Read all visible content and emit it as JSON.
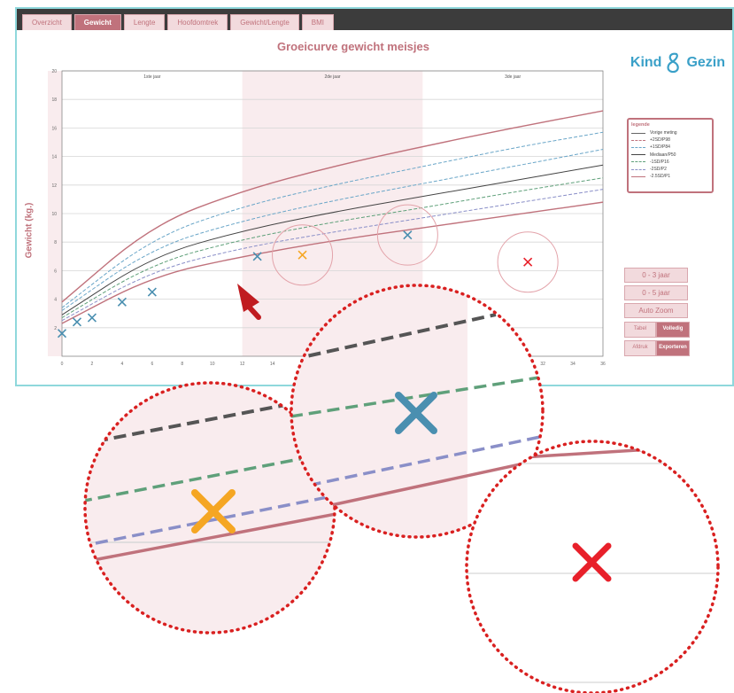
{
  "tabs": [
    {
      "label": "Overzicht",
      "active": false
    },
    {
      "label": "Gewicht",
      "active": true
    },
    {
      "label": "Lengte",
      "active": false
    },
    {
      "label": "Hoofdomtrek",
      "active": false
    },
    {
      "label": "Gewicht/Lengte",
      "active": false
    },
    {
      "label": "BMI",
      "active": false
    }
  ],
  "chart": {
    "title": "Groeicurve gewicht meisjes",
    "ylabel": "Gewicht (kg.)",
    "year_labels": [
      "1ste jaar",
      "2de jaar",
      "3de jaar"
    ]
  },
  "logo": {
    "text_left": "Kind",
    "text_right": "Gezin"
  },
  "legend": {
    "title": "legende",
    "items": [
      "Vorige meting",
      "+2SD/P98",
      "+1SD/P84",
      "Mediaan/P50",
      "-1SD/P16",
      "-2SD/P2",
      "-2.5SD/P1"
    ]
  },
  "buttons": {
    "range_1": "0 - 3 jaar",
    "range_2": "0 - 5 jaar",
    "auto_zoom": "Auto Zoom",
    "toggle_1_left": "Tabel",
    "toggle_1_right": "Volledig",
    "toggle_2_left": "Afdruk",
    "toggle_2_right": "Exporteren"
  },
  "colors": {
    "brand_pink": "#c0727c",
    "measure_blue": "#4a8fb0",
    "measure_orange": "#f5a623",
    "measure_red": "#e8202a",
    "dotted_red": "#d92020"
  },
  "chart_data": {
    "type": "line",
    "xlim": [
      0,
      36
    ],
    "ylim": [
      0,
      20
    ],
    "x_ticks": [
      0,
      2,
      4,
      6,
      8,
      10,
      12,
      14,
      16,
      18,
      20,
      22,
      24,
      26,
      28,
      30,
      32,
      34,
      36
    ],
    "y_ticks": [
      2,
      4,
      6,
      8,
      10,
      12,
      14,
      16,
      18,
      20
    ],
    "series": [
      {
        "values": [
          [
            0,
            3.8
          ],
          [
            6,
            9.2
          ],
          [
            12,
            11.6
          ],
          [
            18,
            13.3
          ],
          [
            24,
            14.7
          ],
          [
            30,
            16.0
          ],
          [
            36,
            17.2
          ]
        ]
      },
      {
        "values": [
          [
            0,
            3.4
          ],
          [
            6,
            8.3
          ],
          [
            12,
            10.5
          ],
          [
            18,
            12.0
          ],
          [
            24,
            13.3
          ],
          [
            30,
            14.6
          ],
          [
            36,
            15.7
          ]
        ]
      },
      {
        "values": [
          [
            0,
            3.2
          ],
          [
            6,
            7.6
          ],
          [
            12,
            9.5
          ],
          [
            18,
            10.9
          ],
          [
            24,
            12.1
          ],
          [
            30,
            13.3
          ],
          [
            36,
            14.5
          ]
        ]
      },
      {
        "values": [
          [
            0,
            2.9
          ],
          [
            6,
            7.0
          ],
          [
            12,
            8.8
          ],
          [
            18,
            10.1
          ],
          [
            24,
            11.2
          ],
          [
            30,
            12.3
          ],
          [
            36,
            13.4
          ]
        ]
      },
      {
        "values": [
          [
            0,
            2.7
          ],
          [
            6,
            6.5
          ],
          [
            12,
            8.2
          ],
          [
            18,
            9.4
          ],
          [
            24,
            10.4
          ],
          [
            30,
            11.5
          ],
          [
            36,
            12.5
          ]
        ]
      },
      {
        "values": [
          [
            0,
            2.5
          ],
          [
            6,
            6.0
          ],
          [
            12,
            7.6
          ],
          [
            18,
            8.7
          ],
          [
            24,
            9.7
          ],
          [
            30,
            10.7
          ],
          [
            36,
            11.7
          ]
        ]
      },
      {
        "values": [
          [
            0,
            2.3
          ],
          [
            6,
            5.6
          ],
          [
            12,
            7.0
          ],
          [
            18,
            8.1
          ],
          [
            24,
            9.0
          ],
          [
            30,
            9.9
          ],
          [
            36,
            10.8
          ]
        ]
      }
    ],
    "measurements": [
      {
        "x": 0,
        "y": 1.6,
        "color": "blue"
      },
      {
        "x": 1,
        "y": 2.4,
        "color": "blue"
      },
      {
        "x": 2,
        "y": 2.7,
        "color": "blue"
      },
      {
        "x": 4,
        "y": 3.8,
        "color": "blue"
      },
      {
        "x": 6,
        "y": 4.5,
        "color": "blue"
      },
      {
        "x": 13,
        "y": 7.0,
        "color": "blue"
      },
      {
        "x": 16,
        "y": 7.1,
        "color": "orange"
      },
      {
        "x": 23,
        "y": 8.5,
        "color": "blue"
      },
      {
        "x": 31,
        "y": 6.6,
        "color": "red"
      }
    ]
  }
}
